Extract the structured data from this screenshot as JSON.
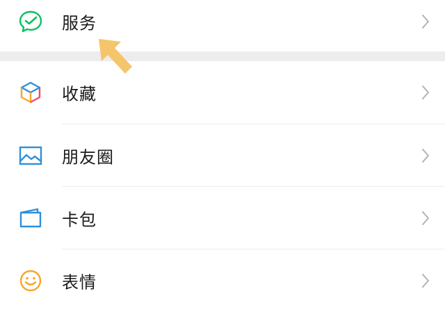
{
  "menu": {
    "items": [
      {
        "label": "服务",
        "icon": "wechat-pay-check-icon"
      },
      {
        "label": "收藏",
        "icon": "cube-favorites-icon"
      },
      {
        "label": "朋友圈",
        "icon": "picture-moments-icon"
      },
      {
        "label": "卡包",
        "icon": "card-wallet-icon"
      },
      {
        "label": "表情",
        "icon": "smiley-sticker-icon"
      }
    ]
  },
  "colors": {
    "green": "#07c160",
    "blue": "#2f8fd8",
    "orange": "#f6a623",
    "chevron": "#b2b2b2",
    "arrow": "#f4c56b"
  }
}
